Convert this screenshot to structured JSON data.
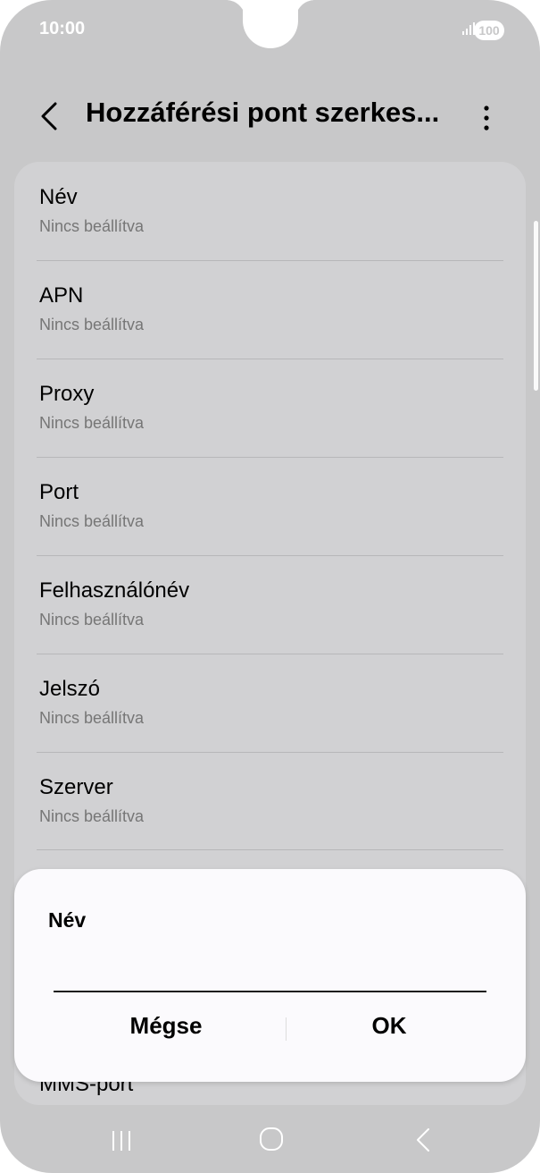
{
  "status": {
    "time": "10:00",
    "battery": "100"
  },
  "header": {
    "title": "Hozzáférési pont szerkes..."
  },
  "settings": [
    {
      "label": "Név",
      "value": "Nincs beállítva"
    },
    {
      "label": "APN",
      "value": "Nincs beállítva"
    },
    {
      "label": "Proxy",
      "value": "Nincs beállítva"
    },
    {
      "label": "Port",
      "value": "Nincs beállítva"
    },
    {
      "label": "Felhasználónév",
      "value": "Nincs beállítva"
    },
    {
      "label": "Jelszó",
      "value": "Nincs beállítva"
    },
    {
      "label": "Szerver",
      "value": "Nincs beállítva"
    }
  ],
  "partial_item": {
    "label": "MMS-port"
  },
  "dialog": {
    "title": "Név",
    "input_value": "",
    "cancel_label": "Mégse",
    "ok_label": "OK"
  },
  "colors": {
    "background": "#c8c8c9",
    "card": "#d1d1d3",
    "dialog": "#fbfafd",
    "secondary_text": "#767676"
  }
}
